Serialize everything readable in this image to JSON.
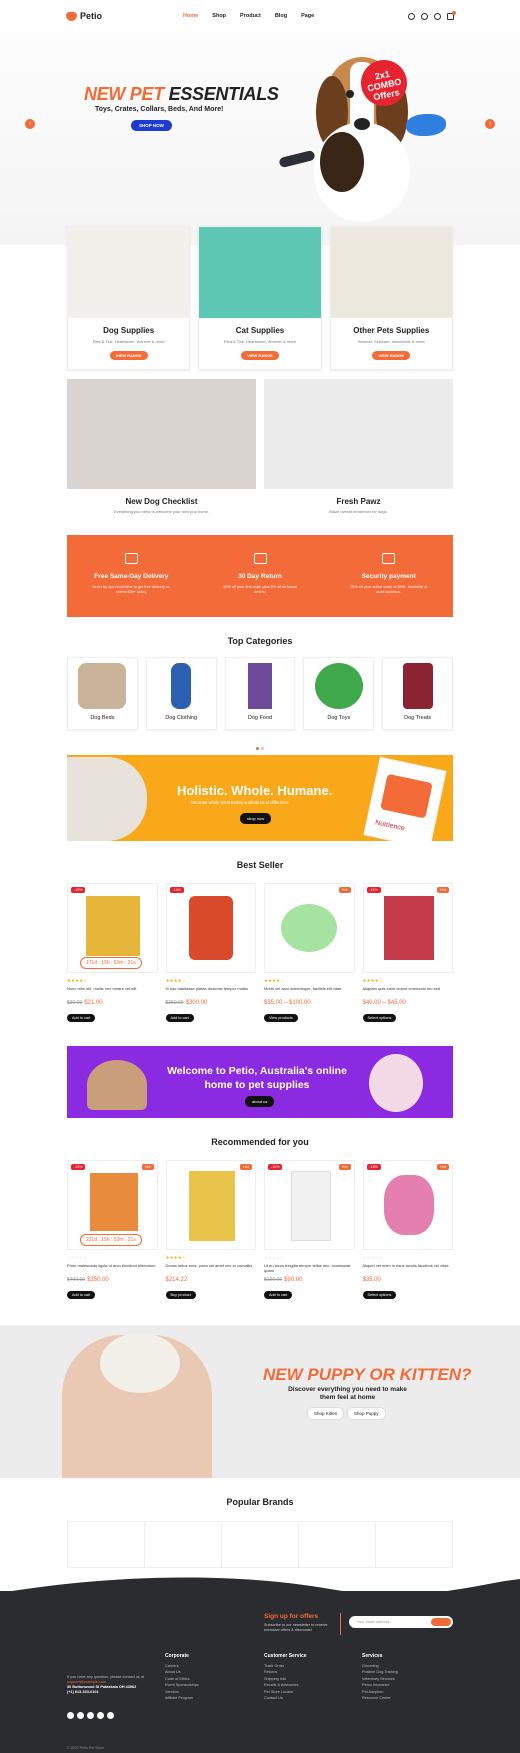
{
  "header": {
    "logo": "Petio",
    "nav": [
      "Home",
      "Shop",
      "Product",
      "Blog",
      "Page"
    ]
  },
  "hero": {
    "title_a": "NEW PET",
    "title_b": "ESSENTIALS",
    "subtitle": "Toys, Crates, Collars, Beds, And More!",
    "button": "SHOP NOW",
    "badge_a": "2x1",
    "badge_b": "COMBO",
    "badge_c": "Offers"
  },
  "supplies": [
    {
      "title": "Dog Supplies",
      "desc": "Flea & Tick, Heartworm, Wormer & more",
      "button": "VIEW RANGE"
    },
    {
      "title": "Cat Supplies",
      "desc": "Flea & Tick, Heartworm, Wormer & more",
      "button": "VIEW RANGE"
    },
    {
      "title": "Other Pets Supplies",
      "desc": "Wormer, Skincare, Insecticide & more",
      "button": "VIEW RANGE"
    }
  ],
  "features": [
    {
      "title": "New Dog Checklist",
      "desc": "Everything you need to welcome your new pup home."
    },
    {
      "title": "Fresh Pawz",
      "desc": "Blaze overall tenderizer for dogs."
    }
  ],
  "services": [
    {
      "title": "Free Same-Day Delivery",
      "desc": "Order by 2pm local time to get free delivery on orders $39+ today."
    },
    {
      "title": "30 Day Return",
      "desc": "35% off your first order plus 5% off all future orders."
    },
    {
      "title": "Security payment",
      "desc": "25% off your online order of $50+. Available at most locations."
    }
  ],
  "top_categories": {
    "title": "Top Categories",
    "items": [
      "Dog Beds",
      "Dog Clothing",
      "Dog Food",
      "Dog Toys",
      "Dog Treats"
    ]
  },
  "banner": {
    "title": "Holistic. Whole. Humane.",
    "desc": "Because whole meat makes a whole lot of difference.",
    "button": "shop now",
    "brand": "Nutrience"
  },
  "best_seller": {
    "title": "Best Seller",
    "items": [
      {
        "tag_l": "-10%",
        "timer": "171d : 15h : 50m : 21s",
        "stars": "★★★★☆",
        "name": "Nunc nibh elit, mollis nec ornare vel elit",
        "old": "$30.00",
        "price": "$21.00",
        "button": "Add to cart"
      },
      {
        "tag_l": "-14%",
        "stars": "★★★★☆",
        "name": "In hac habitasse platea dictumst tempor mattis",
        "old": "$350.00",
        "price": "$300.00",
        "button": "Add to cart"
      },
      {
        "tag_r": "Hot",
        "stars": "★★★★☆",
        "name": "Morbi vel arcu scelerisque, facilisis elit vitae",
        "price": "$35.00 – $100.00",
        "button": "View products"
      },
      {
        "tag_l": "-11%",
        "tag_r": "Hot",
        "stars": "★★★★☆",
        "name": "Aliquam quis enim dolore commodo leo sed",
        "price": "$40.00 – $45.00",
        "button": "Select options"
      }
    ]
  },
  "welcome": {
    "title": "Welcome to Petio, Australia's online home to pet supplies",
    "button": "about us"
  },
  "recommended": {
    "title": "Recommended for you",
    "items": [
      {
        "tag_l": "-13%",
        "tag_r": "Hot",
        "timer": "231d : 15h : 50m : 21s",
        "stars": "☆☆☆☆☆",
        "name": "Proin malesuada ligula ut arcu tincidunt bibendum",
        "old": "$400.00",
        "price": "$350.00",
        "button": "Add to cart"
      },
      {
        "tag_r": "Hot",
        "stars": "★★★★☆",
        "name": "Donec tellus eros, porta vel amet nec in convallis",
        "price": "$214.22",
        "button": "Buy product"
      },
      {
        "tag_l": "-10%",
        "tag_r": "Hot",
        "stars": "☆☆☆☆☆",
        "name": "Ut eu lacus fringilla tempor tellus nec, consequat quam",
        "old": "$100.00",
        "price": "$90.00",
        "button": "Add to cart"
      },
      {
        "tag_l": "-15%",
        "tag_r": "Hot",
        "stars": "☆☆☆☆☆",
        "name": "Aliquet vel enim in risus iaculis faucibus vel vitae",
        "price": "$35.00",
        "button": "Select options"
      }
    ]
  },
  "puppy": {
    "title": "NEW PUPPY OR KITTEN?",
    "desc": "Discover everything you need to make them feel at home",
    "btn1": "Shop Kitten",
    "btn2": "Shop Puppy"
  },
  "brands": {
    "title": "Popular Brands"
  },
  "footer": {
    "signup_title": "Sign up for offers",
    "signup_desc": "Subscribe to our newsletter to receive exclusive offers & discounts!",
    "email_placeholder": "Your email address...",
    "about": "If you have any question, please contact us at",
    "about_email": "support@example.com",
    "address": "30 Buttonwood St Pataskala OH 43062",
    "phone": "(+1) 613-333-0101",
    "cols": [
      {
        "title": "Corporate",
        "items": [
          "Careers",
          "About Us",
          "Code of Ethics",
          "Event Sponsorships",
          "Vendors",
          "Affiliate Program"
        ]
      },
      {
        "title": "Customer Service",
        "items": [
          "Track Order",
          "Returns",
          "Shipping Info",
          "Recalls & Advisories",
          "Pet Store Locator",
          "Contact Us"
        ]
      },
      {
        "title": "Services",
        "items": [
          "Grooming",
          "Positive Dog Training",
          "Veterinary Services",
          "Petco Insurance",
          "Pet Adoption",
          "Resource Center"
        ]
      }
    ],
    "copyright": "© 2022 Petio Pet Store"
  }
}
